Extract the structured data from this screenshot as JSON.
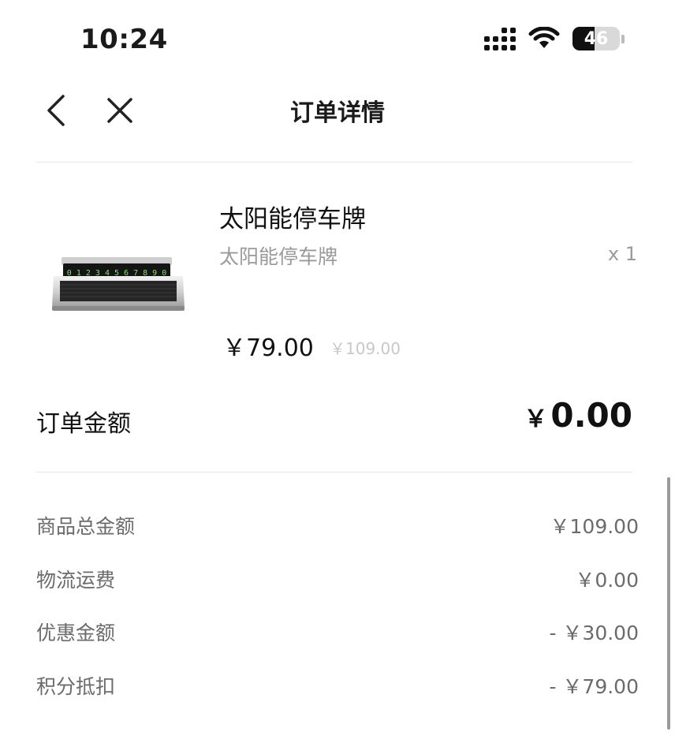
{
  "status_bar": {
    "time": "10:24",
    "battery": "46",
    "battery_level": 0.46
  },
  "nav": {
    "title": "订单详情"
  },
  "product": {
    "name": "太阳能停车牌",
    "subtitle": "太阳能停车牌",
    "quantity": "x 1",
    "price": "￥79.00",
    "original_price": "￥109.00",
    "image_digits": "0 1 2 3 4 5 6 7 8 9 0"
  },
  "order_total": {
    "label": "订单金额",
    "currency": "￥",
    "amount": "0.00"
  },
  "details": [
    {
      "label": "商品总金额",
      "value": "￥109.00"
    },
    {
      "label": "物流运费",
      "value": "￥0.00"
    },
    {
      "label": "优惠金额",
      "value": "- ￥30.00"
    },
    {
      "label": "积分抵扣",
      "value": "- ￥79.00"
    }
  ]
}
